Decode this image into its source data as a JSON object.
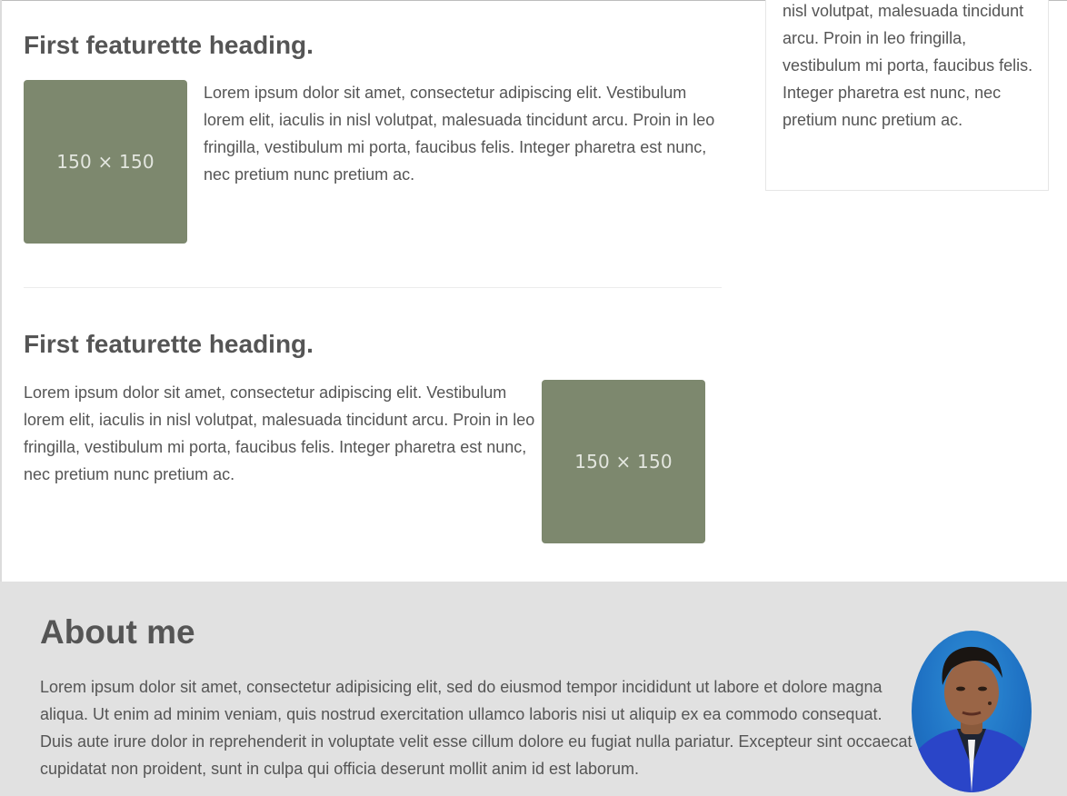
{
  "featurettes": [
    {
      "heading": "First featurette heading.",
      "text": "Lorem ipsum dolor sit amet, consectetur adipiscing elit. Vestibulum lorem elit, iaculis in nisl volutpat, malesuada tincidunt arcu. Proin in leo fringilla, vestibulum mi porta, faucibus felis. Integer pharetra est nunc, nec pretium nunc pretium ac.",
      "image_label": "150 × 150"
    },
    {
      "heading": "First featurette heading.",
      "text": "Lorem ipsum dolor sit amet, consectetur adipiscing elit. Vestibulum lorem elit, iaculis in nisl volutpat, malesuada tincidunt arcu. Proin in leo fringilla, vestibulum mi porta, faucibus felis. Integer pharetra est nunc, nec pretium nunc pretium ac.",
      "image_label": "150 × 150"
    }
  ],
  "sidebar_card": {
    "text": "Vestibulum lorem elit, iaculis in nisl volutpat, malesuada tincidunt arcu. Proin in leo fringilla, vestibulum mi porta, faucibus felis. Integer pharetra est nunc, nec pretium nunc pretium ac."
  },
  "about": {
    "title": "About me",
    "text": "Lorem ipsum dolor sit amet, consectetur adipisicing elit, sed do eiusmod tempor incididunt ut labore et dolore magna aliqua. Ut enim ad minim veniam, quis nostrud exercitation ullamco laboris nisi ut aliquip ex ea commodo consequat. Duis aute irure dolor in reprehenderit in voluptate velit esse cillum dolore eu fugiat nulla pariatur. Excepteur sint occaecat cupidatat non proident, sunt in culpa qui officia deserunt mollit anim id est laborum."
  },
  "colors": {
    "placeholder": "#7d886e",
    "text": "#555555",
    "about_bg": "#e1e1e1"
  }
}
